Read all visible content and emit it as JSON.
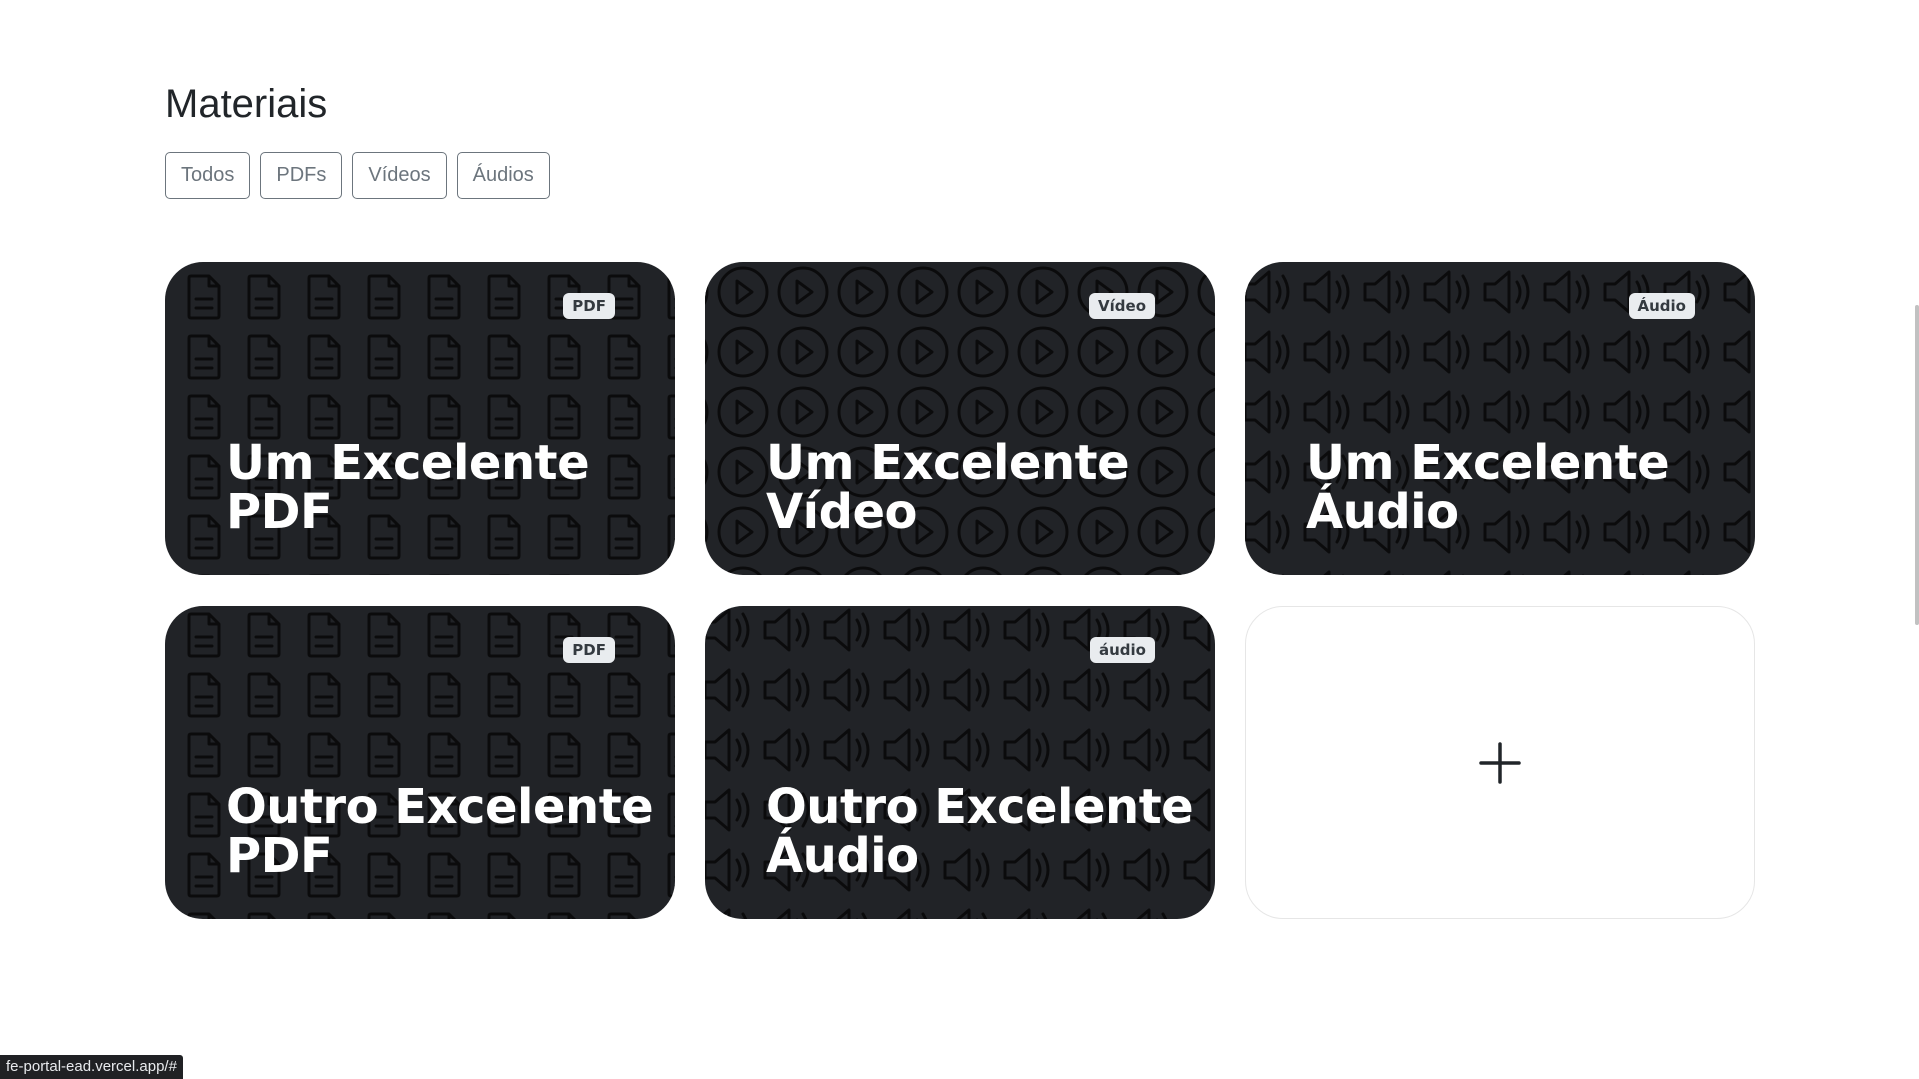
{
  "section": {
    "title": "Materiais"
  },
  "filters": [
    {
      "label": "Todos"
    },
    {
      "label": "PDFs"
    },
    {
      "label": "Vídeos"
    },
    {
      "label": "Áudios"
    }
  ],
  "cards": [
    {
      "badge": "PDF",
      "title": "Um Excelente PDF",
      "icon": "file-text-icon"
    },
    {
      "badge": "Vídeo",
      "title": "Um Excelente Vídeo",
      "icon": "play-circle-icon"
    },
    {
      "badge": "Áudio",
      "title": "Um Excelente Áudio",
      "icon": "volume-icon"
    },
    {
      "badge": "PDF",
      "title": "Outro Excelente PDF",
      "icon": "file-text-icon"
    },
    {
      "badge": "áudio",
      "title": "Outro Excelente Áudio",
      "icon": "volume-icon"
    }
  ],
  "add_card": {
    "icon": "plus-icon"
  },
  "status_bar": {
    "url": "fe-portal-ead.vercel.app/#"
  },
  "colors": {
    "card_background": "#212327",
    "pattern_stroke": "#0b0b0c",
    "badge_background": "#e9ecef",
    "filter_border": "#6c757d"
  }
}
